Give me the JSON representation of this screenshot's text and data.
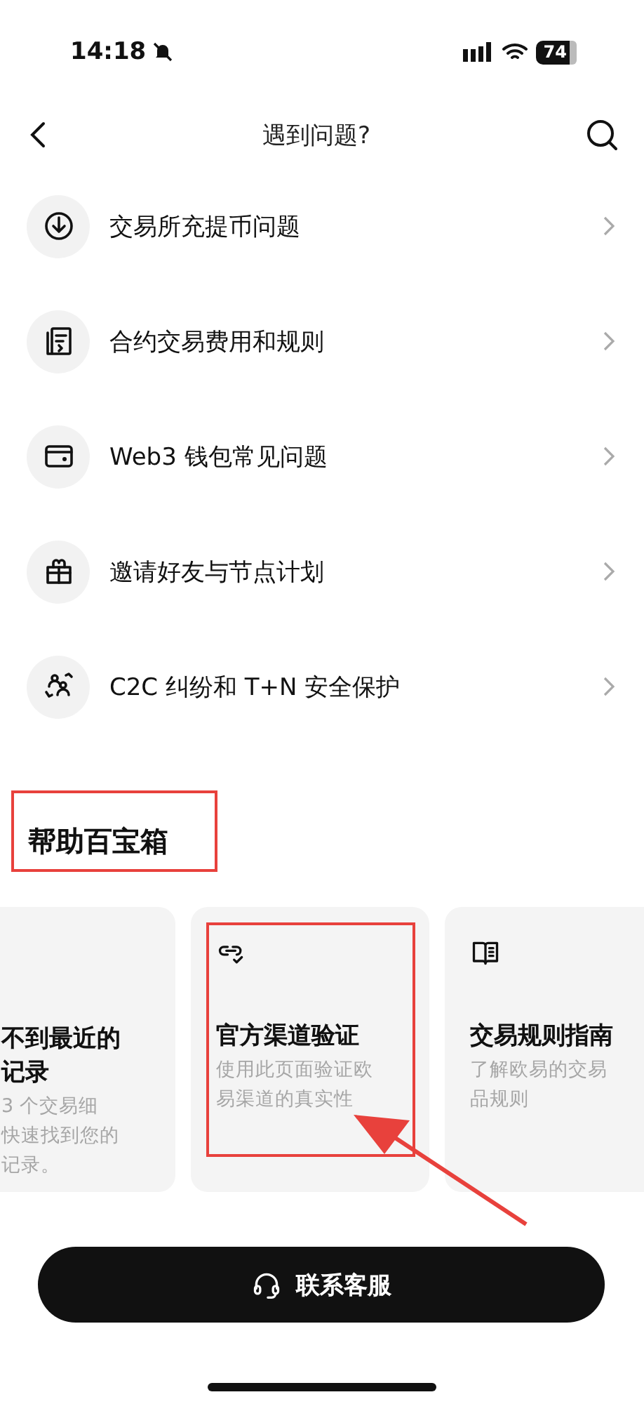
{
  "status_bar": {
    "time": "14:18",
    "battery": "74"
  },
  "nav": {
    "title": "遇到问题?"
  },
  "menu": [
    {
      "kind": "download",
      "label": "交易所充提币问题"
    },
    {
      "kind": "document",
      "label": "合约交易费用和规则"
    },
    {
      "kind": "wallet",
      "label": "Web3 钱包常见问题"
    },
    {
      "kind": "gift",
      "label": "邀请好友与节点计划"
    },
    {
      "kind": "people",
      "label": "C2C 纠纷和 T+N 安全保护"
    }
  ],
  "toolbox": {
    "title": "帮助百宝箱",
    "cards": [
      {
        "kind": "partial",
        "title_lines": [
          "不到最近的",
          "记录"
        ],
        "description_lines": [
          "3 个交易细",
          "快速找到您的",
          "记录。"
        ]
      },
      {
        "kind": "link",
        "title_lines": [
          "官方渠道验证"
        ],
        "description_lines": [
          "使用此页面验证欧",
          "易渠道的真实性"
        ]
      },
      {
        "kind": "book",
        "title_lines": [
          "交易规则指南"
        ],
        "description_lines": [
          "了解欧易的交易",
          "品规则"
        ]
      }
    ]
  },
  "contact_button": {
    "label": "联系客服"
  }
}
